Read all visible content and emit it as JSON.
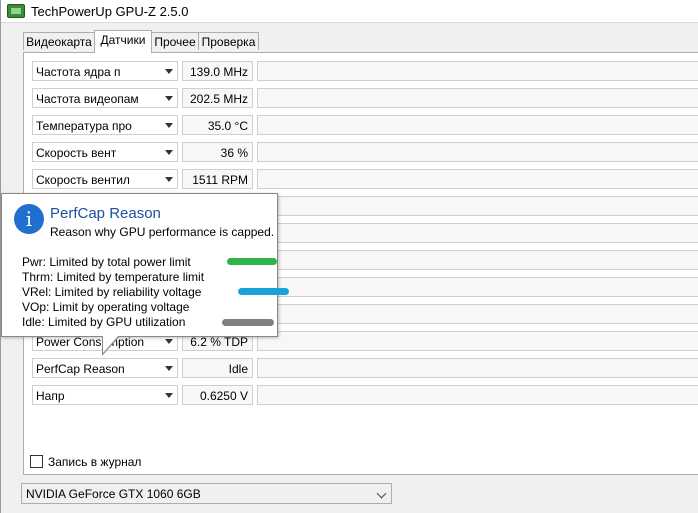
{
  "window": {
    "title": "TechPowerUp GPU-Z 2.5.0"
  },
  "tabs": [
    {
      "label": "Видеокарта"
    },
    {
      "label": "Датчики"
    },
    {
      "label": "Прочее"
    },
    {
      "label": "Проверка"
    }
  ],
  "sensors": [
    {
      "name": "Частота ядра п",
      "value": "139.0 MHz"
    },
    {
      "name": "Частота видеопам",
      "value": "202.5 MHz"
    },
    {
      "name": "Температура про",
      "value": "35.0 °C"
    },
    {
      "name": "Скорость вент",
      "value": "36 %"
    },
    {
      "name": "Скорость вентил",
      "value": "1511 RPM"
    },
    {
      "name": "Power Consumption",
      "value": "6.2 % TDP"
    },
    {
      "name": "PerfCap Reason",
      "value": "Idle"
    },
    {
      "name": "Напр",
      "value": "0.6250 V"
    }
  ],
  "tooltip": {
    "icon": "info-icon",
    "title": "PerfCap Reason",
    "subtitle": "Reason why GPU performance is capped.",
    "lines": [
      "Pwr: Limited by total power limit",
      "Thrm: Limited by temperature limit",
      "VRel: Limited by reliability voltage",
      "VOp: Limit by operating voltage",
      "Idle: Limited by GPU utilization"
    ],
    "marker_colors": {
      "pwr": "#2db34a",
      "vrel": "#1aa3d9",
      "idle": "#808080"
    }
  },
  "log": {
    "label": "Запись в журнал",
    "checked": false
  },
  "gpu_select": {
    "value": "NVIDIA GeForce GTX 1060 6GB"
  },
  "colors": {
    "info_blue": "#1e6fcf",
    "title_blue": "#1e4fa0"
  }
}
